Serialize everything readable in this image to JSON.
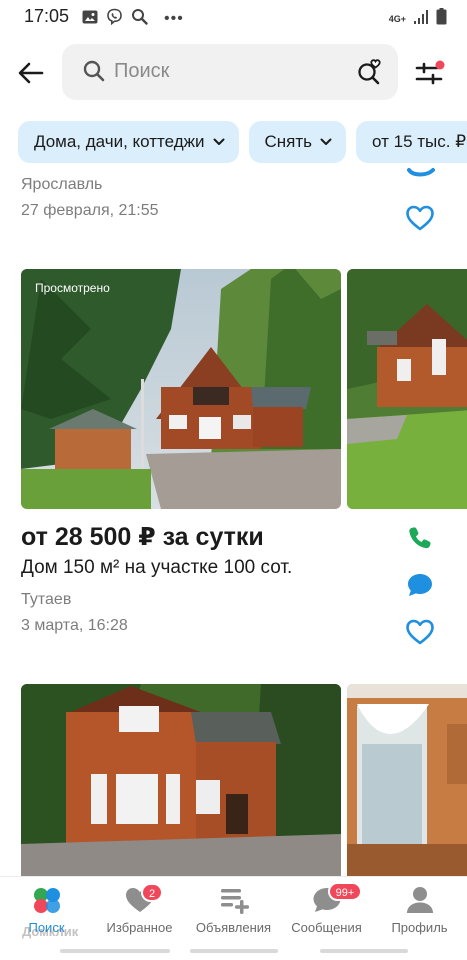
{
  "status_bar": {
    "time": "17:05",
    "network": "4G+"
  },
  "search": {
    "placeholder": "Поиск"
  },
  "chips": [
    {
      "label": "Дома, дачи, коттеджи"
    },
    {
      "label": "Снять"
    },
    {
      "label": "от 15 тыс. ₽"
    }
  ],
  "previous_listing": {
    "city": "Ярославль",
    "date": "27 февраля, 21:55"
  },
  "listing_1": {
    "viewed": "Просмотрено",
    "price": "от 28 500 ₽ за сутки",
    "description": "Дом 150 м² на участке 100 сот.",
    "city": "Тутаев",
    "date": "3 марта, 16:28"
  },
  "nav": {
    "items": [
      {
        "label": "Поиск"
      },
      {
        "label": "Избранное",
        "badge": "2"
      },
      {
        "label": "Объявления"
      },
      {
        "label": "Сообщения",
        "badge": "99+"
      },
      {
        "label": "Профиль"
      }
    ]
  },
  "watermark": "Домклик",
  "colors": {
    "accent": "#1f8fe0",
    "chip_bg": "#dbeefb",
    "phone_green": "#1ea85a",
    "badge_red": "#f1475a"
  },
  "icons": {
    "back": "arrow-left-icon",
    "search": "search-icon",
    "saved_search": "saved-search-icon",
    "filter": "filter-sliders-icon",
    "chip_dropdown": "chevron-down-icon",
    "favorite": "heart-icon",
    "call": "phone-icon",
    "chat": "chat-icon"
  }
}
